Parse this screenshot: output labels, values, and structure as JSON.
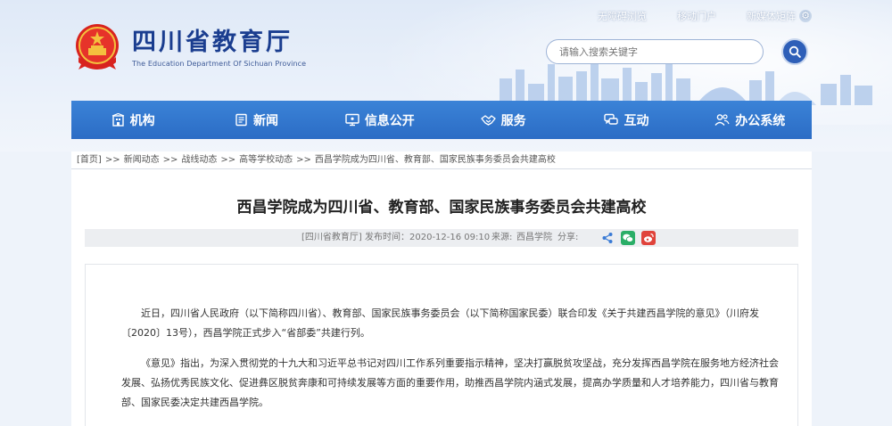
{
  "header": {
    "links": [
      {
        "label": "无障碍浏览"
      },
      {
        "label": "移动门户"
      },
      {
        "label": "新媒体矩阵"
      }
    ],
    "logo_cn": "四川省教育厅",
    "logo_en": "The Education Department Of Sichuan Province",
    "search_placeholder": "请输入搜索关键字"
  },
  "nav": {
    "items": [
      {
        "label": "机构",
        "icon": "building-icon"
      },
      {
        "label": "新闻",
        "icon": "news-icon"
      },
      {
        "label": "信息公开",
        "icon": "monitor-icon"
      },
      {
        "label": "服务",
        "icon": "handshake-icon"
      },
      {
        "label": "互动",
        "icon": "chat-icon"
      },
      {
        "label": "办公系统",
        "icon": "people-icon"
      }
    ]
  },
  "breadcrumb": [
    "[首页]",
    "新闻动态",
    "战线动态",
    "高等学校动态",
    "西昌学院成为四川省、教育部、国家民族事务委员会共建高校"
  ],
  "breadcrumb_sep": ">>",
  "article": {
    "title": "西昌学院成为四川省、教育部、国家民族事务委员会共建高校",
    "meta": {
      "source_tag": "[四川省教育厅]",
      "publish_label": "发布时间：",
      "publish_time": "2020-12-16 09:10",
      "origin_label": "来源:",
      "origin": "西昌学院",
      "share_label": "分享:"
    },
    "paragraphs": [
      "近日，四川省人民政府（以下简称四川省）、教育部、国家民族事务委员会（以下简称国家民委）联合印发《关于共建西昌学院的意见》（川府发〔2020〕13号），西昌学院正式步入“省部委”共建行列。",
      "《意见》指出，为深入贯彻党的十九大和习近平总书记对四川工作系列重要指示精神，坚决打赢脱贫攻坚战，充分发挥西昌学院在服务地方经济社会发展、弘扬优秀民族文化、促进彝区脱贫奔康和可持续发展等方面的重要作用，助推西昌学院内涵式发展，提高办学质量和人才培养能力，四川省与教育部、国家民委决定共建西昌学院。"
    ]
  },
  "colors": {
    "nav_blue": "#2b6cc5",
    "logo_blue": "#1a3d8f",
    "wechat_green": "#2aae67",
    "weibo_red": "#e0433b",
    "share_blue": "#3a7bd5"
  }
}
